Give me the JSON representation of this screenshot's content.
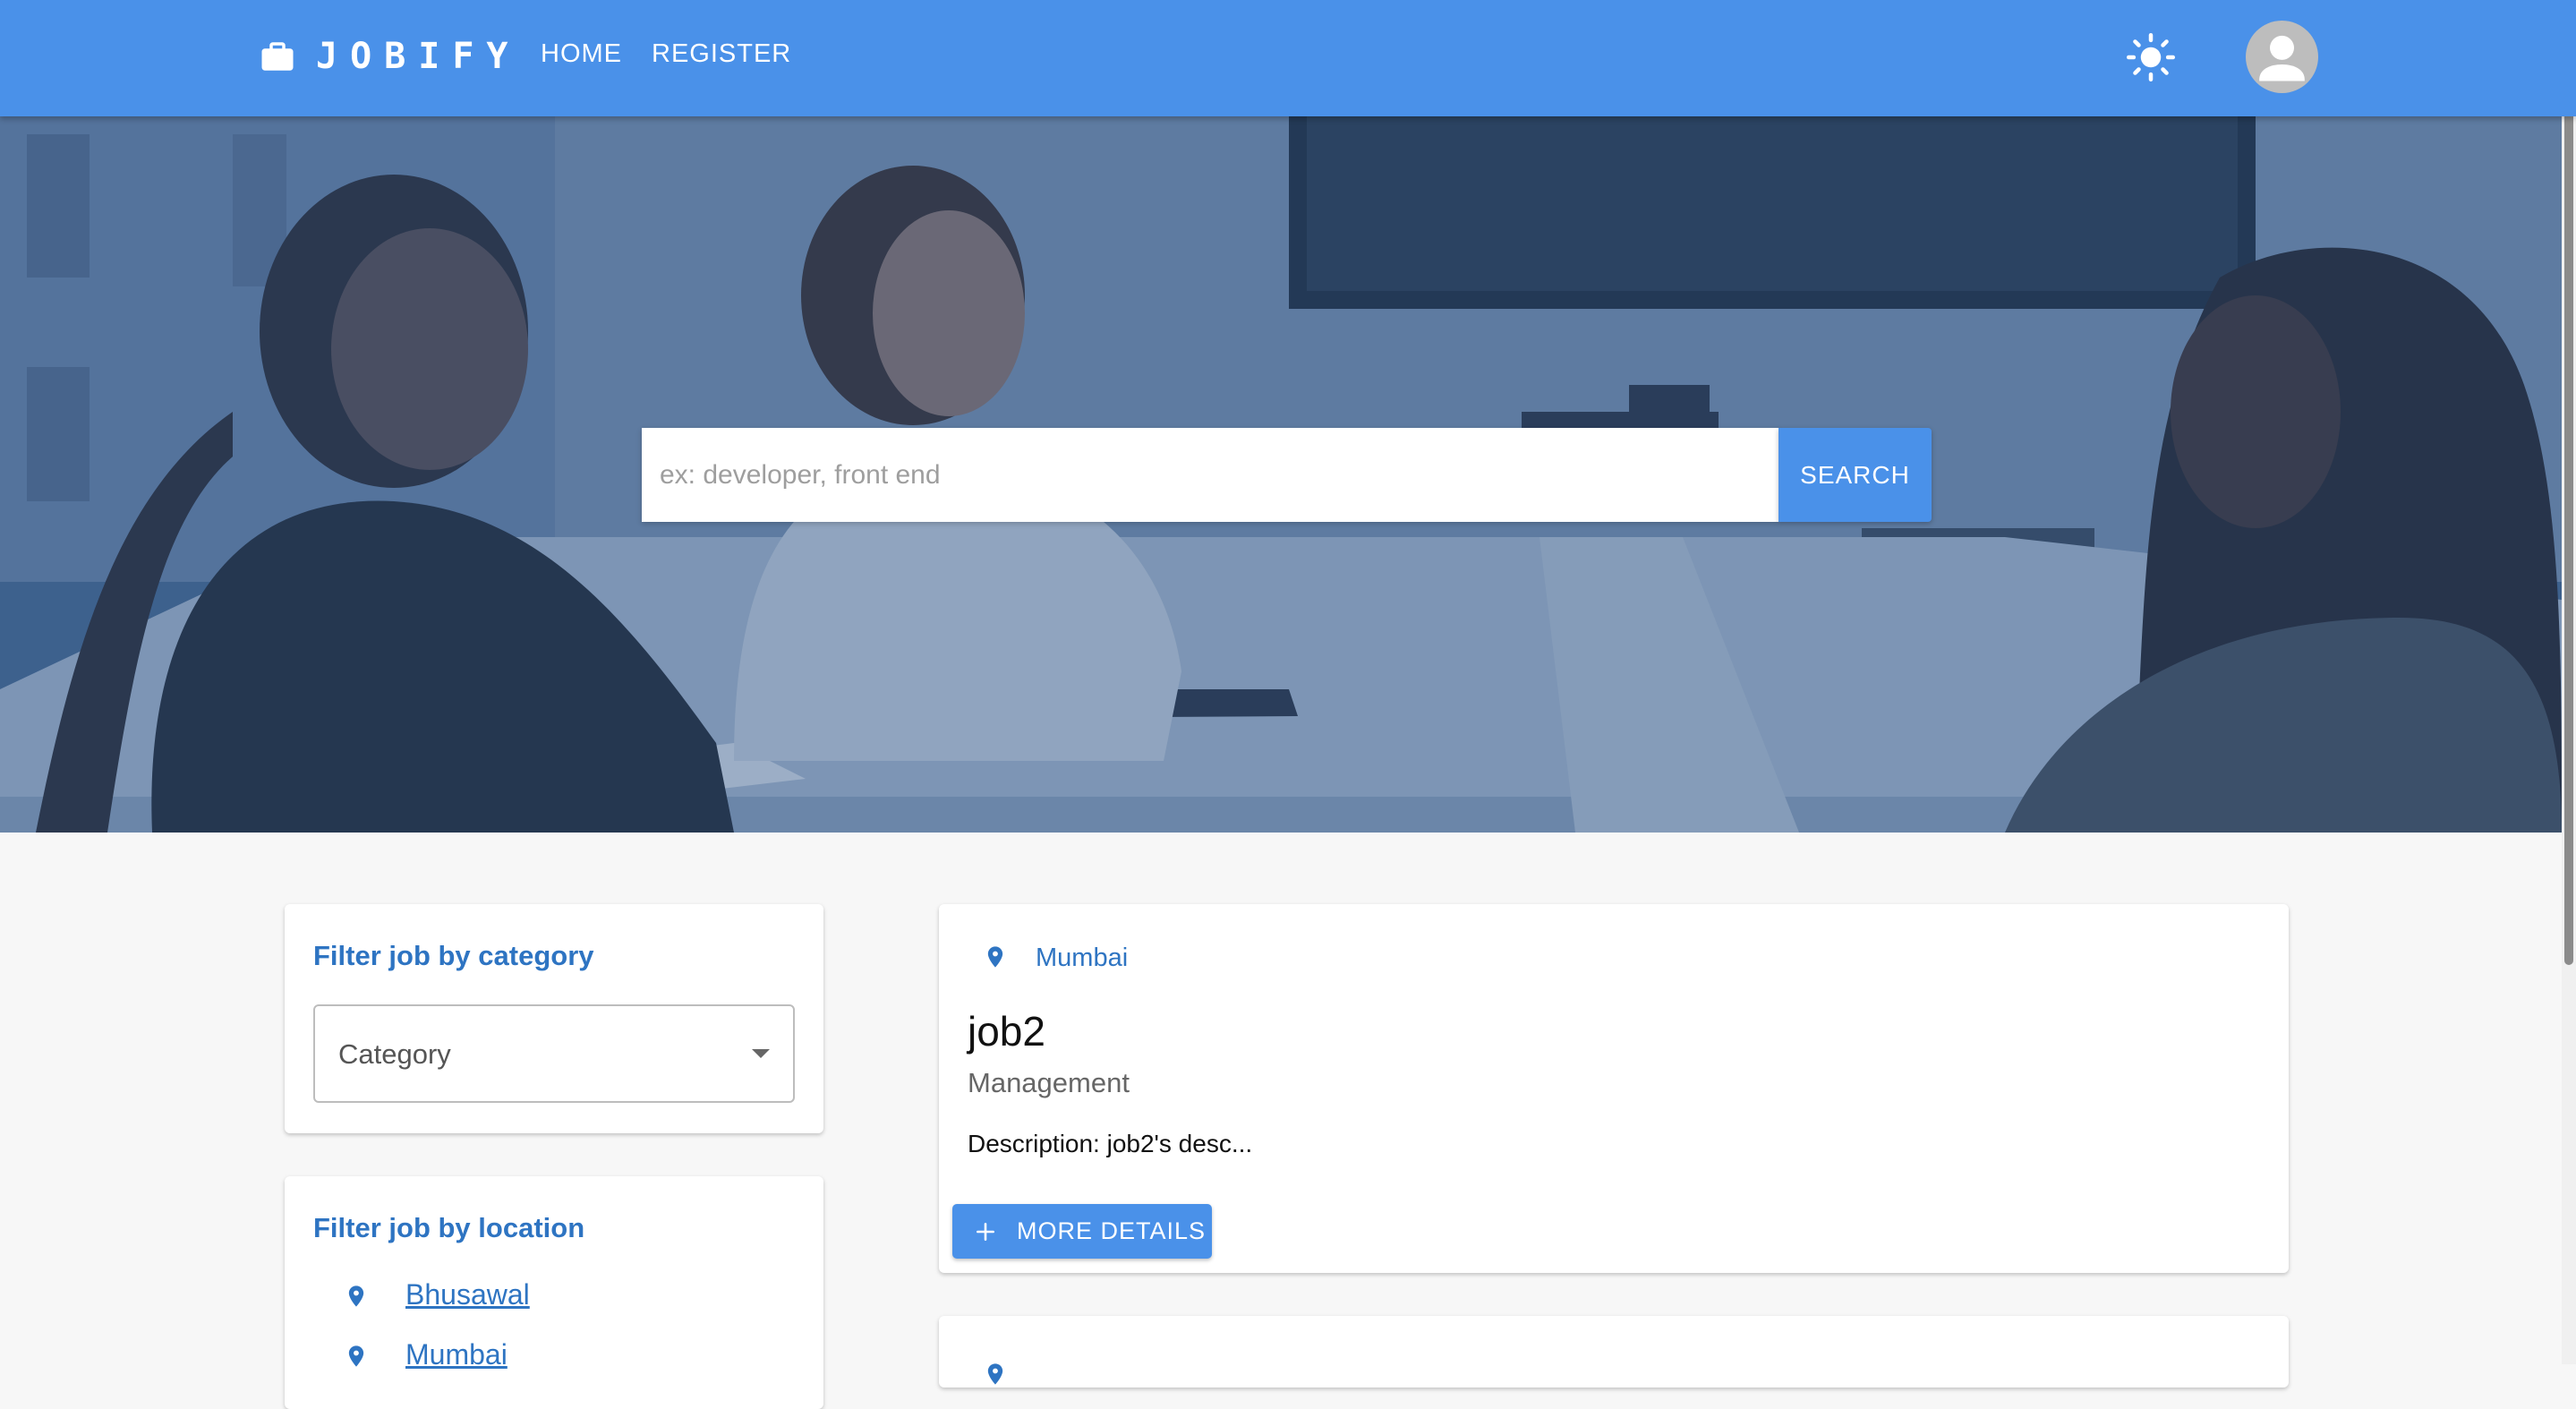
{
  "header": {
    "brand": "JOBIFY",
    "logo_icon": "briefcase-icon",
    "nav": [
      {
        "label": "HOME"
      },
      {
        "label": "REGISTER"
      }
    ],
    "theme_icon": "sun-icon",
    "avatar_icon": "person-icon",
    "accent_color": "#4a91e9"
  },
  "hero": {
    "search_placeholder": "ex: developer, front end",
    "search_button": "SEARCH"
  },
  "filters": {
    "category": {
      "title": "Filter job by category",
      "select_label": "Category"
    },
    "location": {
      "title": "Filter job by location",
      "items": [
        {
          "label": "Bhusawal"
        },
        {
          "label": "Mumbai"
        }
      ]
    }
  },
  "jobs": [
    {
      "location": "Mumbai",
      "title": "job2",
      "category": "Management",
      "description": "Description: job2's desc...",
      "button": "MORE DETAILS"
    }
  ]
}
